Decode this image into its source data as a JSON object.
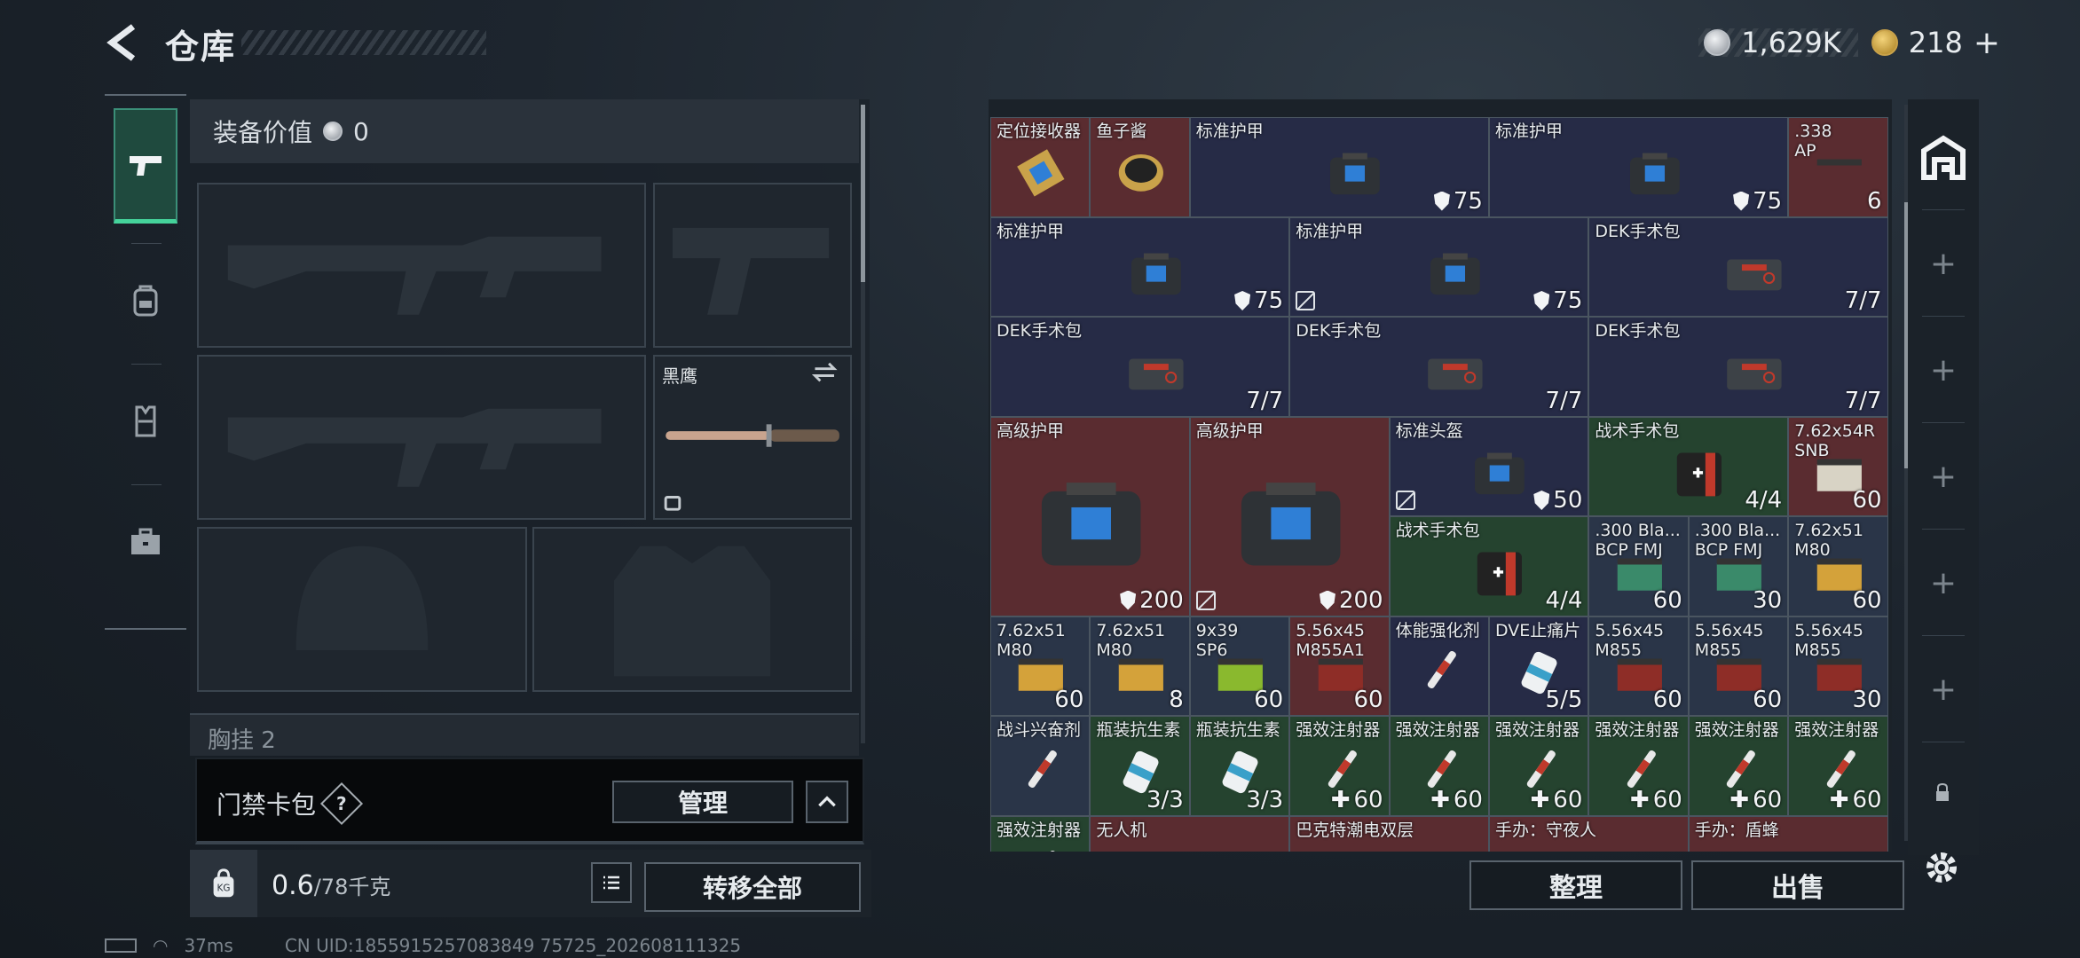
{
  "header": {
    "title": "仓库",
    "silver_amount": "1,629K",
    "gold_amount": "218",
    "gold_add": "+"
  },
  "equipment": {
    "value_label": "装备价值",
    "value_amount": "0",
    "knife_name": "黑鹰",
    "chest_label": "胸挂",
    "chest_count": "2"
  },
  "keycard": {
    "label": "门禁卡包",
    "help": "?",
    "manage": "管理"
  },
  "bottom_left": {
    "weight_current": "0.6",
    "weight_max": "/78千克",
    "kg_icon": "KG",
    "transfer_all": "转移全部"
  },
  "bottom_right": {
    "sort": "整理",
    "sell": "出售"
  },
  "status_bar": {
    "ping": "37ms",
    "uid": "CN UID:1855915257083849 75725_202608111325"
  },
  "inventory": {
    "cells": [
      {
        "name": "定位接收器",
        "count": "",
        "bg": "#5a2c30"
      },
      {
        "name": "鱼子酱",
        "count": "",
        "bg": "#5a2c30"
      },
      {
        "name": "标准护甲",
        "count": "75",
        "bg": "#262b46"
      },
      {
        "name": "标准护甲",
        "count": "75",
        "bg": "#262b46"
      },
      {
        "name": ".338\nAP",
        "count": "6",
        "bg": "#5a2c30"
      },
      {
        "name": "标准护甲",
        "count": "75",
        "bg": "#262b46"
      },
      {
        "name": "标准护甲",
        "count": "75",
        "bg": "#262b46"
      },
      {
        "name": "DEK手术包",
        "count": "7/7",
        "bg": "#262b46"
      },
      {
        "name": "DEK手术包",
        "count": "7/7",
        "bg": "#262b46"
      },
      {
        "name": "DEK手术包",
        "count": "7/7",
        "bg": "#262b46"
      },
      {
        "name": "DEK手术包",
        "count": "7/7",
        "bg": "#262b46"
      },
      {
        "name": "高级护甲",
        "count": "200",
        "bg": "#5a2c30"
      },
      {
        "name": "高级护甲",
        "count": "200",
        "bg": "#5a2c30"
      },
      {
        "name": "标准头盔",
        "count": "50",
        "bg": "#262b46"
      },
      {
        "name": "战术手术包",
        "count": "4/4",
        "bg": "#25432f"
      },
      {
        "name": "7.62x54R\nSNB",
        "count": "60",
        "bg": "#5a2c30"
      },
      {
        "name": "战术手术包",
        "count": "4/4",
        "bg": "#25432f"
      },
      {
        "name": ".300 Bla...\nBCP FMJ",
        "count": "60",
        "bg": "#2a3548"
      },
      {
        "name": ".300 Bla...\nBCP FMJ",
        "count": "30",
        "bg": "#2a3548"
      },
      {
        "name": "7.62x51\nM80",
        "count": "60",
        "bg": "#2a3548"
      },
      {
        "name": "7.62x51\nM80",
        "count": "60",
        "bg": "#2a3548"
      },
      {
        "name": "7.62x51\nM80",
        "count": "8",
        "bg": "#2a3548"
      },
      {
        "name": "9x39\nSP6",
        "count": "60",
        "bg": "#2a3548"
      },
      {
        "name": "5.56x45\nM855A1",
        "count": "60",
        "bg": "#5a2c30"
      },
      {
        "name": "体能强化剂",
        "count": "",
        "bg": "#262b46"
      },
      {
        "name": "DVE止痛片",
        "count": "5/5",
        "bg": "#262b46"
      },
      {
        "name": "5.56x45\nM855",
        "count": "60",
        "bg": "#2a3548"
      },
      {
        "name": "5.56x45\nM855",
        "count": "60",
        "bg": "#2a3548"
      },
      {
        "name": "5.56x45\nM855",
        "count": "30",
        "bg": "#2a3548"
      },
      {
        "name": "战斗兴奋剂",
        "count": "",
        "bg": "#2a3548"
      },
      {
        "name": "瓶装抗生素",
        "count": "3/3",
        "bg": "#25432f"
      },
      {
        "name": "瓶装抗生素",
        "count": "3/3",
        "bg": "#25432f"
      },
      {
        "name": "强效注射器",
        "count": "60",
        "bg": "#25432f"
      },
      {
        "name": "强效注射器",
        "count": "60",
        "bg": "#25432f"
      },
      {
        "name": "强效注射器",
        "count": "60",
        "bg": "#25432f"
      },
      {
        "name": "强效注射器",
        "count": "60",
        "bg": "#25432f"
      },
      {
        "name": "强效注射器",
        "count": "60",
        "bg": "#25432f"
      },
      {
        "name": "强效注射器",
        "count": "60",
        "bg": "#25432f"
      },
      {
        "name": "强效注射器",
        "count": "",
        "bg": "#25432f"
      },
      {
        "name": "无人机",
        "count": "",
        "bg": "#5a2c30"
      },
      {
        "name": "巴克特潮电双层",
        "count": "",
        "bg": "#5a2c30"
      },
      {
        "name": "手办：守夜人",
        "count": "",
        "bg": "#5a2c30"
      },
      {
        "name": "手办：盾蜂",
        "count": "",
        "bg": "#5a2c30"
      }
    ]
  }
}
